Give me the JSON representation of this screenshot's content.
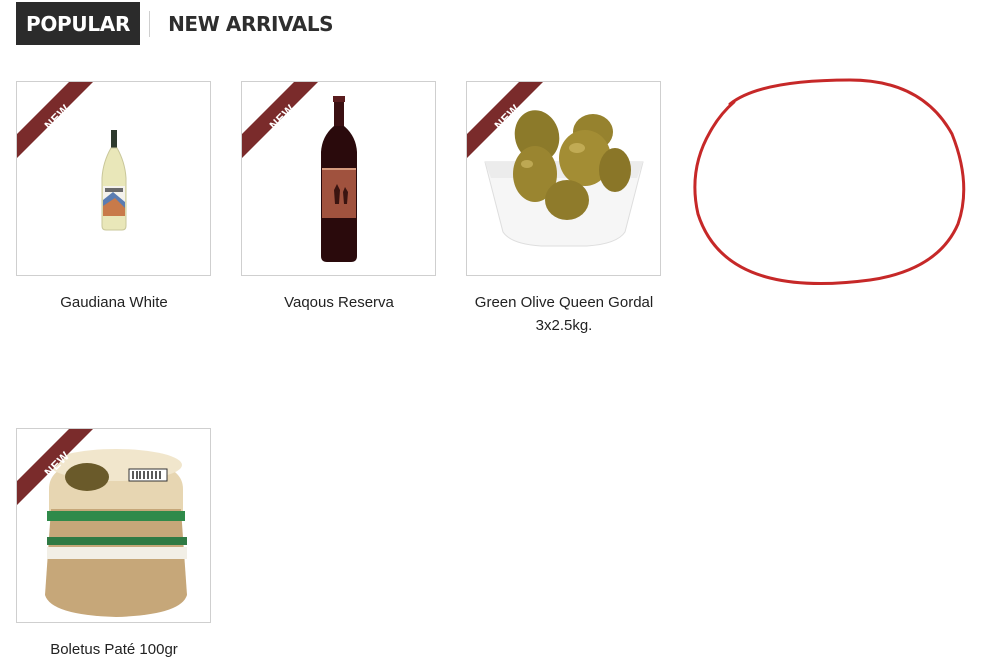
{
  "tabs": {
    "popular": "POPULAR",
    "new_arrivals": "NEW ARRIVALS"
  },
  "badge_label": "NEW",
  "products": [
    {
      "name": "Gaudiana White"
    },
    {
      "name": "Vaqous Reserva"
    },
    {
      "name": "Green Olive Queen Gordal 3x2.5kg."
    },
    {
      "name": "Boletus Paté 100gr"
    }
  ],
  "colors": {
    "tab_active_bg": "#2b2b2b",
    "ribbon": "#7a2b2b",
    "annotation": "#c62828"
  }
}
